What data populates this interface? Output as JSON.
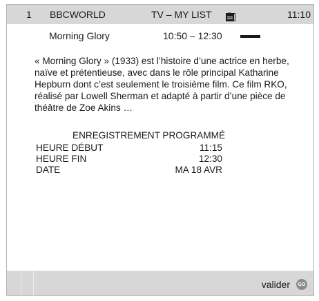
{
  "header": {
    "channel_number": "1",
    "channel_name": "BBCWORLD",
    "list_name": "TV – MY LIST",
    "icons": [
      "speaker-icon",
      "dolby-icon",
      "lock-icon",
      "subtitle-icon"
    ],
    "time": "11:10"
  },
  "program": {
    "title": "Morning  Glory",
    "time_range": "10:50 – 12:30",
    "progress_fraction": 0.45
  },
  "description": "« Morning Glory » (1933) est l’histoire d’une actrice en herbe, naïve et prétentieuse, avec dans le rôle principal Katharine Hepburn dont c’est seulement le troisième film. Ce film RKO, réalisé par Lowell Sherman et adapté à partir d’une pièce de théâtre de Zoe Akins …",
  "recording": {
    "heading": "ENREGISTREMENT PROGRAMMÉ",
    "rows": [
      {
        "label": "HEURE DÉBUT",
        "value": "11:15"
      },
      {
        "label": "HEURE FIN",
        "value": "12:30"
      },
      {
        "label": "DATE",
        "value": "MA 18 AVR"
      }
    ]
  },
  "footer": {
    "action_label": "valider",
    "go_label": "GO"
  }
}
